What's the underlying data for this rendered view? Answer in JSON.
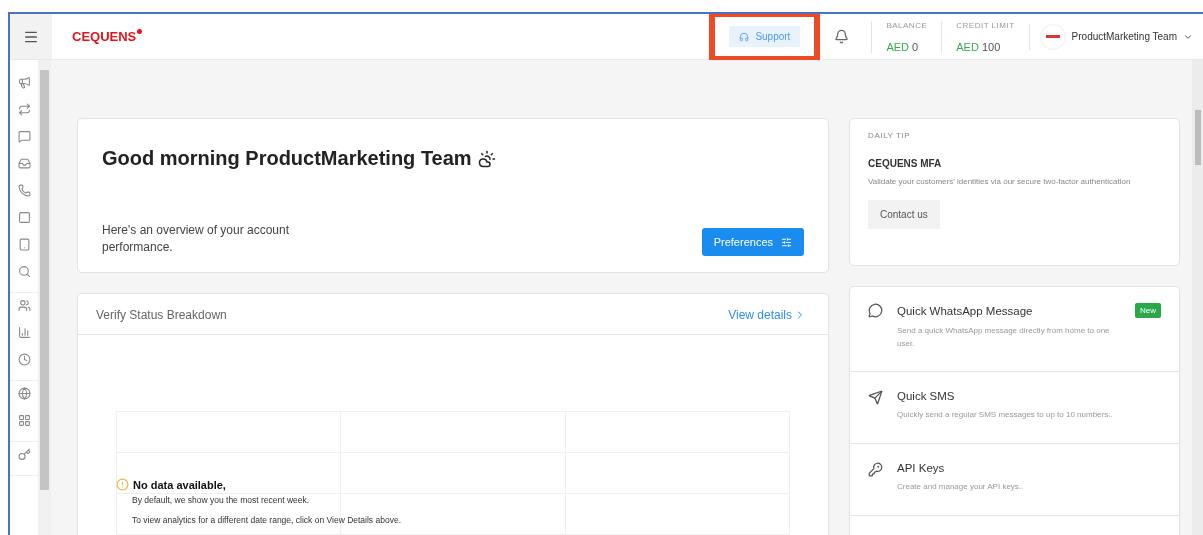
{
  "header": {
    "logo": "CEQUENS",
    "support": {
      "label": "Support",
      "highlighted": true
    },
    "stats": [
      {
        "label": "BALANCE",
        "currency": "AED",
        "amount": "0"
      },
      {
        "label": "CREDIT LIMIT",
        "currency": "AED",
        "amount": "100"
      }
    ],
    "account": {
      "name": "ProductMarketing Team"
    }
  },
  "welcome": {
    "title": "Good morning ProductMarketing Team",
    "subtitle": "Here's an overview of your account performance.",
    "button": "Preferences"
  },
  "daily_tip": {
    "label": "DAILY TIP",
    "title": "CEQUENS MFA",
    "text": "Validate your customers' identities via our secure two-factor authentication",
    "button": "Contact us"
  },
  "verify": {
    "title": "Verify Status Breakdown",
    "link": "View details",
    "empty": {
      "title": "No data available,",
      "lines": [
        "By default, we show you the most recent week.",
        "To view analytics for a different date range, click on View Details above."
      ]
    }
  },
  "quick_actions": [
    {
      "kind": "whatsapp",
      "title": "Quick WhatsApp Message",
      "text": "Send a quick WhatsApp message directly from home to one user.",
      "badge": "New"
    },
    {
      "kind": "sms",
      "title": "Quick SMS",
      "text": "Quickly send a regular SMS messages to up to 10 numbers.."
    },
    {
      "kind": "key",
      "title": "API Keys",
      "text": "Create and manage your API keys.."
    }
  ]
}
